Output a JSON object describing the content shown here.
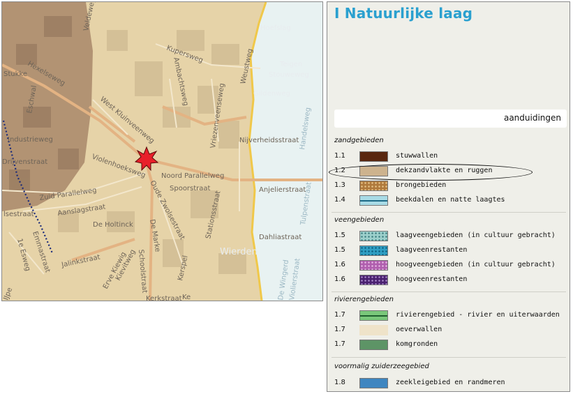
{
  "map": {
    "streets": {
      "velde": "Veldeweg",
      "hoefslag": "Hoefslag",
      "kupers": "Kupersweg",
      "ambacht": "Ambachtsweg",
      "teigen": "Teigen",
      "stouwe": "Stouweweg",
      "weustweg": "Weustweg",
      "gilden": "Gildenweg",
      "hexel": "Hexelseweg",
      "stukke": "Stukke",
      "eschwal": "Eschwal",
      "westklui": "West Kluinveenweg",
      "handel": "Handelsweg",
      "industrie": "Industrieweg",
      "vriezen": "Vriezenveenseweg",
      "nijverheid": "Nijverheidsstraat",
      "violen": "Violenhoeksweg",
      "rijven": "Drijvenstraat",
      "noordpar": "Noord Parallelweg",
      "spoor": "Spoorstraat",
      "anjelier": "Anjelierstraat",
      "tulpen": "Tulpenstraat",
      "zuidpar": "Zuid Parallelweg",
      "oudezw": "Oude Zwolsestraat",
      "aanslag": "Aanslagstraat",
      "holtinck": "De Holtinck",
      "station": "Stationsstraat",
      "seestraat": "lsestraat",
      "emmast": "Emmastraat",
      "demarke": "De Marke",
      "dahlia": "Dahliastraat",
      "esweg": "1e Esweg",
      "jalink": "Jalinkstraat",
      "kievit": "Kievitweg",
      "erve": "Erve Kiewig",
      "school": "Schoolstraat",
      "kerspel": "Kerspel",
      "wierden": "Wierden",
      "wingerd": "De Wingerd",
      "violier": "Violierstraat",
      "kerk": "Kerkstraat",
      "ke": "Ke",
      "iype": "IJpe"
    }
  },
  "panel": {
    "title": "I Natuurlijke laag",
    "search_text": "aanduidingen",
    "categories": {
      "zand": "zandgebieden",
      "veen": "veengebieden",
      "rivier": "rivierengebieden",
      "zuiderzee": "voormalig zuiderzeegebied"
    },
    "legend": [
      {
        "num": "1.1",
        "label": "stuwwallen",
        "color": "#5a2810"
      },
      {
        "num": "1.2",
        "label": "dekzandvlakte en ruggen",
        "color": "#cdb38e"
      },
      {
        "num": "1.3",
        "label": "brongebieden",
        "color": "#b07a3c"
      },
      {
        "num": "1.4",
        "label": "beekdalen en natte laagtes",
        "color": "#a8dbe6"
      },
      {
        "num": "1.5",
        "label": "laagveengebieden (in cultuur gebracht)",
        "color": "#9ccfcb"
      },
      {
        "num": "1.5",
        "label": "laagveenrestanten",
        "color": "#2f9fc4"
      },
      {
        "num": "1.6",
        "label": "hoogveengebieden (in cultuur gebracht)",
        "color": "#b05fae"
      },
      {
        "num": "1.6",
        "label": "hoogveenrestanten",
        "color": "#4a2170"
      },
      {
        "num": "1.7",
        "label": "rivierengebied - rivier en uiterwaarden",
        "color": "#79c77a"
      },
      {
        "num": "1.7",
        "label": "oeverwallen",
        "color": "#efe3c9"
      },
      {
        "num": "1.7",
        "label": "komgronden",
        "color": "#5d9466"
      },
      {
        "num": "1.8",
        "label": "zeekleigebied en randmeren",
        "color": "#3f86c0"
      }
    ]
  }
}
